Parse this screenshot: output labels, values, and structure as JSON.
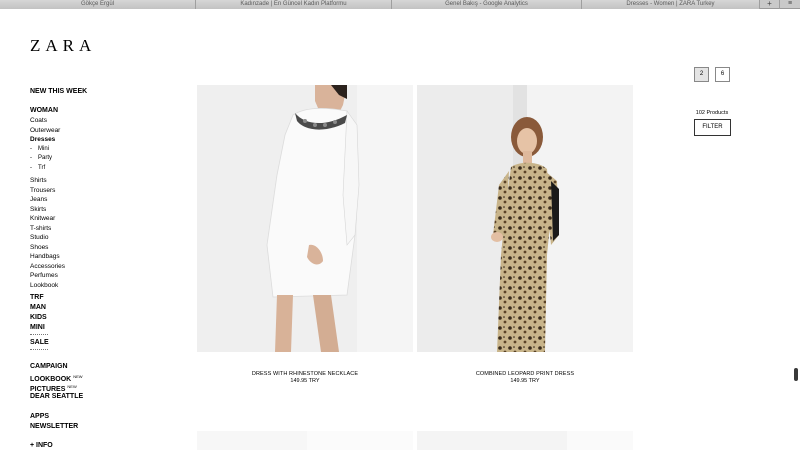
{
  "browser": {
    "tabs": [
      "Gökçe Ergül",
      "Kadınzade | En Güncel Kadın Platformu",
      "Genel Bakış - Google Analytics",
      "Dresses - Women | ZARA Turkey"
    ],
    "new_tab_label": "+",
    "tab_list_icon": "≡"
  },
  "brand": {
    "logo": "ZARA"
  },
  "sidebar": {
    "new_this_week": "NEW THIS WEEK",
    "woman": "WOMAN",
    "coats": "Coats",
    "outerwear": "Outerwear",
    "dresses": "Dresses",
    "mini": "Mini",
    "party": "Party",
    "trf_sub": "Trf",
    "shirts": "Shirts",
    "trousers": "Trousers",
    "jeans": "Jeans",
    "skirts": "Skirts",
    "knitwear": "Knitwear",
    "tshirts": "T-shirts",
    "studio": "Studio",
    "shoes": "Shoes",
    "handbags": "Handbags",
    "accessories": "Accessories",
    "perfumes": "Perfumes",
    "lookbook_sub": "Lookbook",
    "trf": "TRF",
    "man": "MAN",
    "kids": "KIDS",
    "mini_top": "MINI",
    "sale": "SALE",
    "campaign": "CAMPAIGN",
    "lookbook": "LOOKBOOK",
    "pictures": "PICTURES",
    "new_badge": "NEW",
    "dear_seattle": "DEAR SEATTLE",
    "apps": "APPS",
    "newsletter": "NEWSLETTER",
    "info": "+ INFO"
  },
  "products": [
    {
      "name": "DRESS WITH RHINESTONE NECKLACE",
      "price": "149.95 TRY"
    },
    {
      "name": "COMBINED LEOPARD PRINT DRESS",
      "price": "149.95 TRY"
    }
  ],
  "view_options": {
    "grid_2": "2",
    "grid_6": "6"
  },
  "product_count": "102 Products",
  "filter_label": "FILTER"
}
